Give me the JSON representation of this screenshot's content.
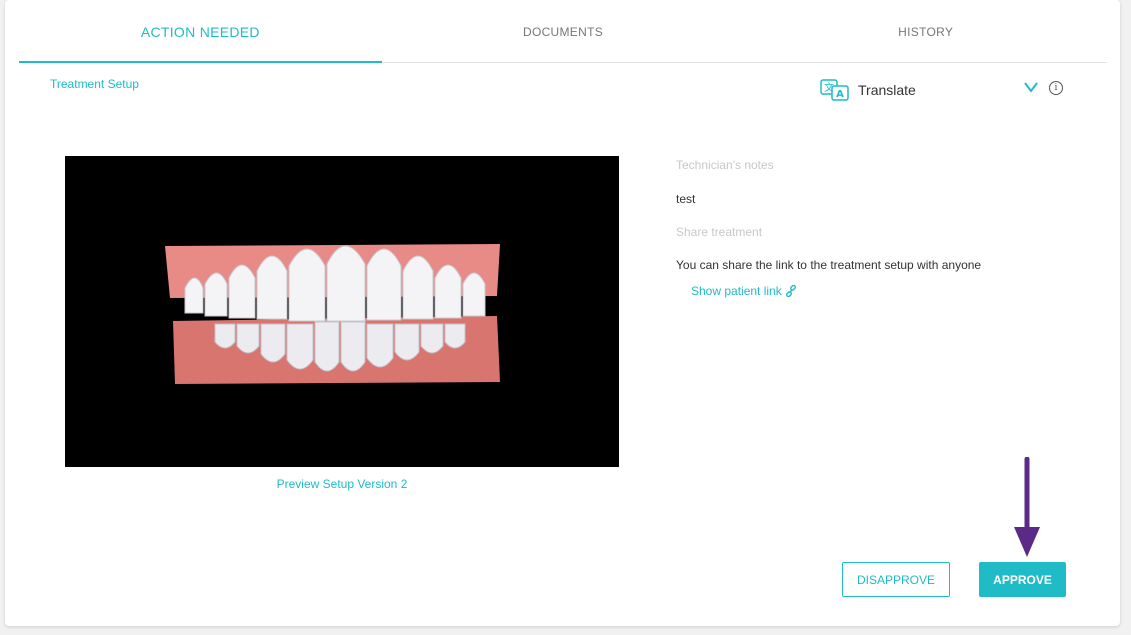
{
  "tabs": [
    {
      "label": "ACTION NEEDED",
      "active": true
    },
    {
      "label": "DOCUMENTS",
      "active": false
    },
    {
      "label": "HISTORY",
      "active": false
    }
  ],
  "section": {
    "title": "Treatment Setup"
  },
  "translate": {
    "label": "Translate",
    "icon": "translate-icon"
  },
  "preview": {
    "caption": "Preview Setup Version 2"
  },
  "notes": {
    "label": "Technician's notes",
    "value": "test"
  },
  "share": {
    "label": "Share treatment",
    "description": "You can share the link to the treatment setup with anyone",
    "link_label": "Show patient link"
  },
  "actions": {
    "disapprove_label": "DISAPPROVE",
    "approve_label": "APPROVE"
  },
  "colors": {
    "accent": "#1fbcc7",
    "arrow": "#5b2a86"
  }
}
